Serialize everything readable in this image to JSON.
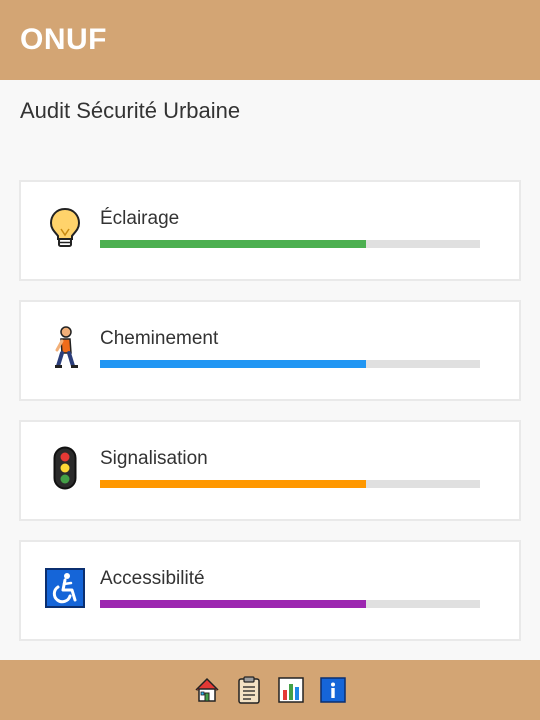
{
  "app": {
    "brand": "ONUF"
  },
  "page": {
    "title": "Audit Sécurité Urbaine"
  },
  "categories": [
    {
      "label": "Éclairage",
      "icon": "light-bulb-icon",
      "color": "#4caf50",
      "score": 0.7
    },
    {
      "label": "Cheminement",
      "icon": "walking-person-icon",
      "color": "#2196f3",
      "score": 0.7
    },
    {
      "label": "Signalisation",
      "icon": "traffic-light-icon",
      "color": "#ff9800",
      "score": 0.7
    },
    {
      "label": "Accessibilité",
      "icon": "wheelchair-icon",
      "color": "#9c27b0",
      "score": 0.7
    }
  ],
  "footer_nav": [
    {
      "icon": "home-icon"
    },
    {
      "icon": "clipboard-icon"
    },
    {
      "icon": "bar-chart-icon"
    },
    {
      "icon": "info-icon"
    }
  ]
}
